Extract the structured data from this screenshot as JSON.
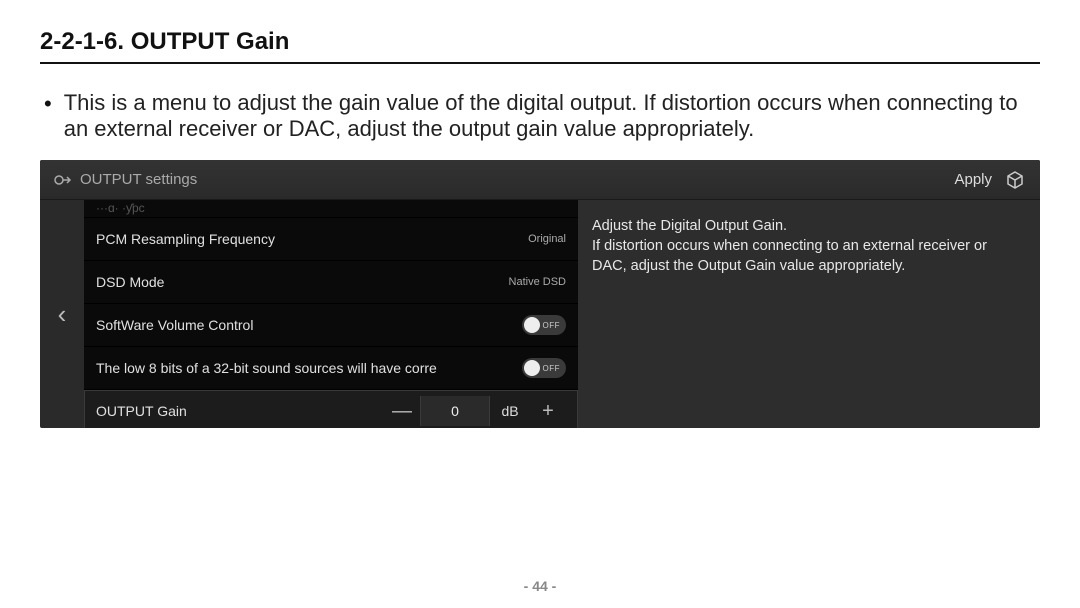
{
  "doc": {
    "section_title": "2-2-1-6. OUTPUT Gain",
    "bullet": "This is a menu to adjust the gain value of the digital output. If distortion occurs when connecting to an external receiver or DAC, adjust the output gain value appropriately.",
    "page_number": "- 44 -"
  },
  "device": {
    "header_title": "OUTPUT settings",
    "apply_label": "Apply",
    "cutoff_label": "···ɑ· ·ƴpс",
    "rows": {
      "pcm": {
        "label": "PCM Resampling Frequency",
        "value": "Original"
      },
      "dsd": {
        "label": "DSD Mode",
        "value": "Native DSD"
      },
      "svc": {
        "label": "SoftWare Volume Control",
        "toggle": "OFF"
      },
      "low8": {
        "label": "The low 8 bits of a 32-bit sound sources will have corre",
        "toggle": "OFF"
      },
      "gain": {
        "label": "OUTPUT Gain",
        "minus": "—",
        "value": "0",
        "unit": "dB",
        "plus": "+"
      }
    },
    "info": {
      "line1": "Adjust the Digital Output Gain.",
      "line2": "If distortion occurs when connecting to an external receiver or DAC, adjust the Output Gain value appropriately."
    }
  }
}
